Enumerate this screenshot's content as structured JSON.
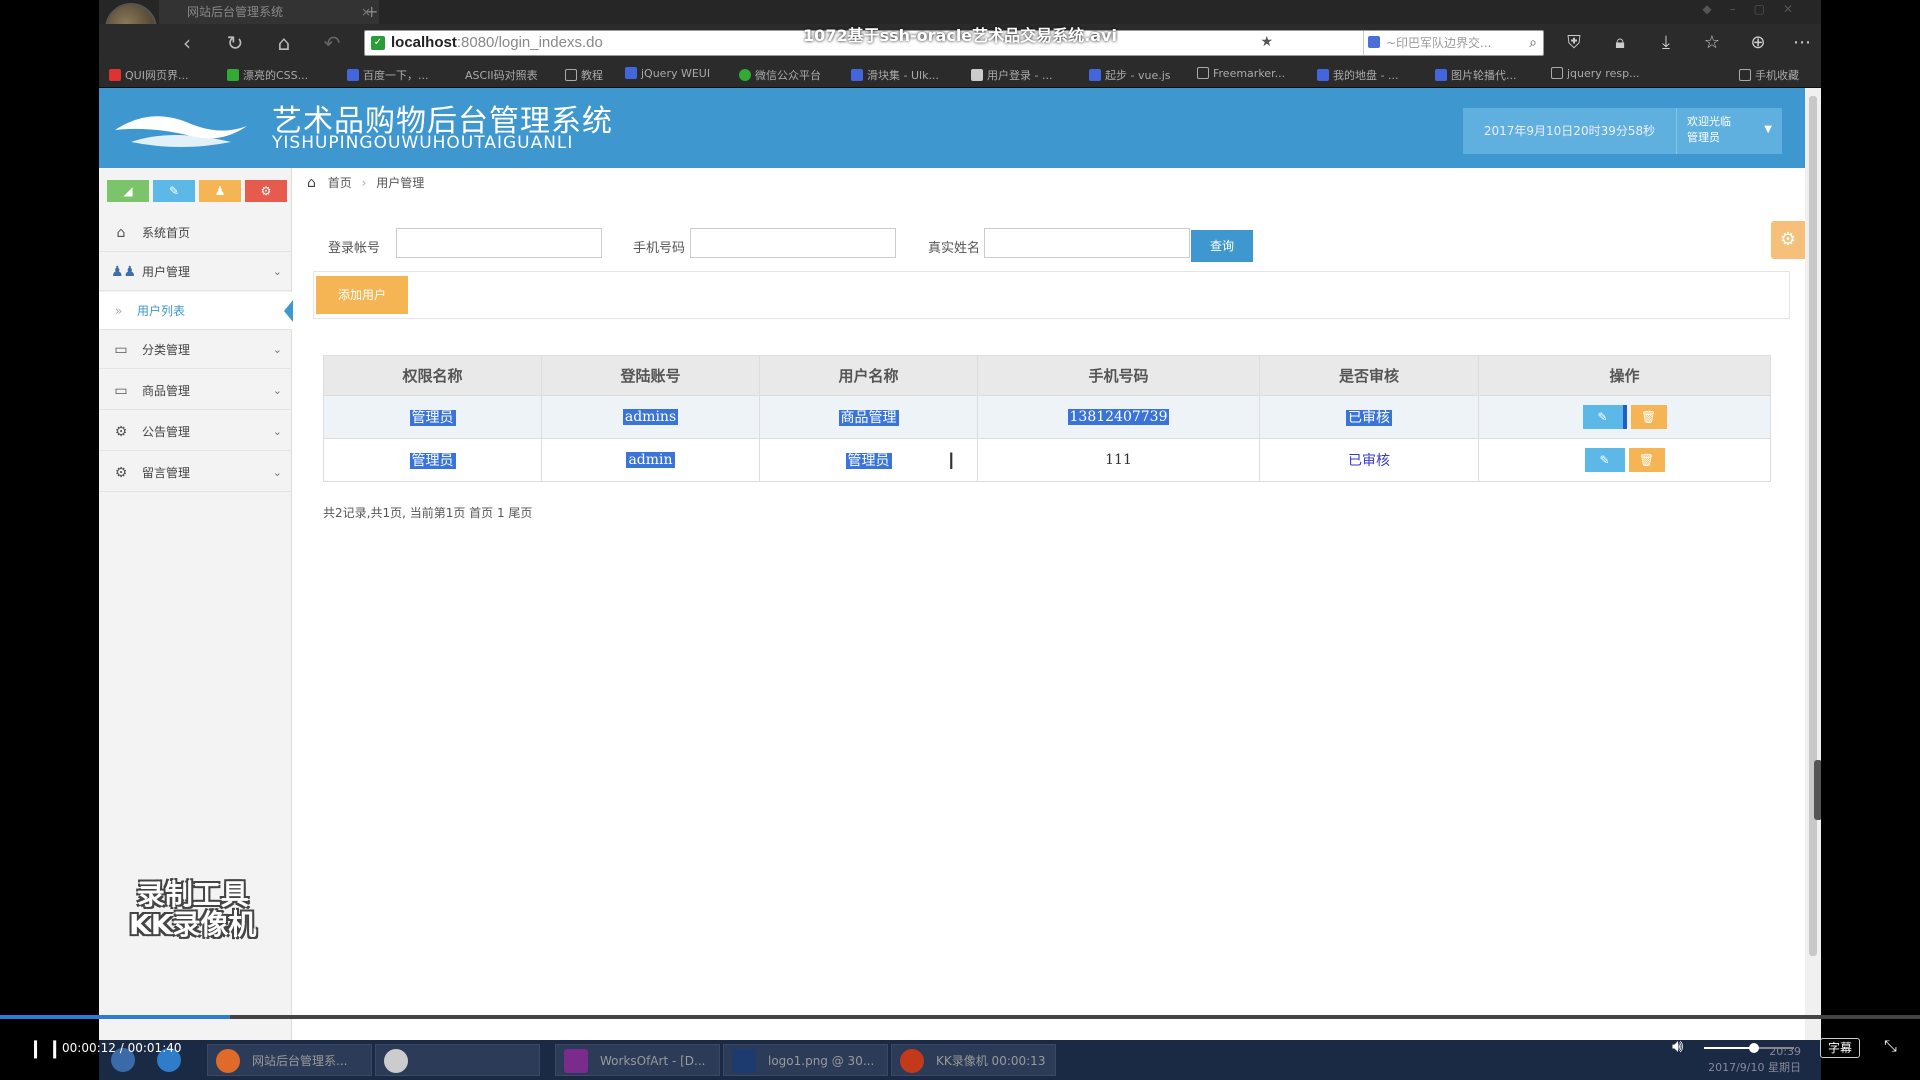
{
  "video": {
    "title": "1072基于ssh-oracle艺术品交易系统.avi",
    "time_current": "00:00:12",
    "time_total": "00:01:40",
    "time_separator": "/",
    "progress_fraction": 0.12,
    "volume_fraction": 0.55,
    "subtitle_label": "字幕"
  },
  "browser": {
    "tab_title": "网站后台管理系统",
    "url_host": "localhost",
    "url_rest": ":8080/login_indexs.do",
    "search_placeholder": "~印巴军队边界交...",
    "bookmarks": [
      "QUI网页界...",
      "漂亮的CSS...",
      "百度一下，...",
      "ASCII码对照表",
      "教程",
      "jQuery WEUI",
      "微信公众平台",
      "滑块集 - Ulk...",
      "用户登录 - ...",
      "起步 - vue.js",
      "Freemarker...",
      "我的地盘 - ...",
      "图片轮播代...",
      "jquery resp...",
      "手机收藏"
    ]
  },
  "app": {
    "brand_cn": "艺术品购物后台管理系统",
    "brand_en": "YISHUPINGOUWUHOUTAIGUANLI",
    "header_time": "2017年9月10日20时39分58秒",
    "welcome_line1": "欢迎光临",
    "welcome_line2": "管理员",
    "colors": {
      "header": "#3f97cf",
      "primary": "#3f97cf",
      "warning": "#f5b555",
      "selection": "#3a74d8"
    }
  },
  "sidebar": {
    "items": [
      {
        "label": "系统首页",
        "icon": "home-icon"
      },
      {
        "label": "用户管理",
        "icon": "users-icon"
      },
      {
        "label": "分类管理",
        "icon": "monitor-icon"
      },
      {
        "label": "商品管理",
        "icon": "monitor-icon"
      },
      {
        "label": "公告管理",
        "icon": "cogs-icon"
      },
      {
        "label": "留言管理",
        "icon": "cogs-icon"
      }
    ],
    "submenu_label": "用户列表",
    "watermark_line1": "录制工具",
    "watermark_line2": "KK录像机"
  },
  "breadcrumb": {
    "home": "首页",
    "current": "用户管理"
  },
  "search": {
    "label_account": "登录帐号",
    "label_phone": "手机号码",
    "label_realname": "真实姓名",
    "query_button": "查询"
  },
  "toolbar": {
    "add_label": "添加用户"
  },
  "table": {
    "headers": [
      "权限名称",
      "登陆账号",
      "用户名称",
      "手机号码",
      "是否审核",
      "操作"
    ],
    "rows": [
      {
        "role": "管理员",
        "account": "admins",
        "name": "商品管理",
        "phone": "13812407739",
        "audit": "已审核"
      },
      {
        "role": "管理员",
        "account": "admin",
        "name": "管理员",
        "phone": "111",
        "audit": "已审核"
      }
    ]
  },
  "pager": {
    "text": "共2记录,共1页, 当前第1页 首页 1 尾页"
  },
  "taskbar": {
    "items": [
      "网站后台管理系...",
      "",
      "WorksOfArt - [D...",
      "logo1.png @ 30...",
      "KK录像机 00:00:13"
    ],
    "clock_time": "20:39",
    "clock_date": "2017/9/10 星期日"
  }
}
